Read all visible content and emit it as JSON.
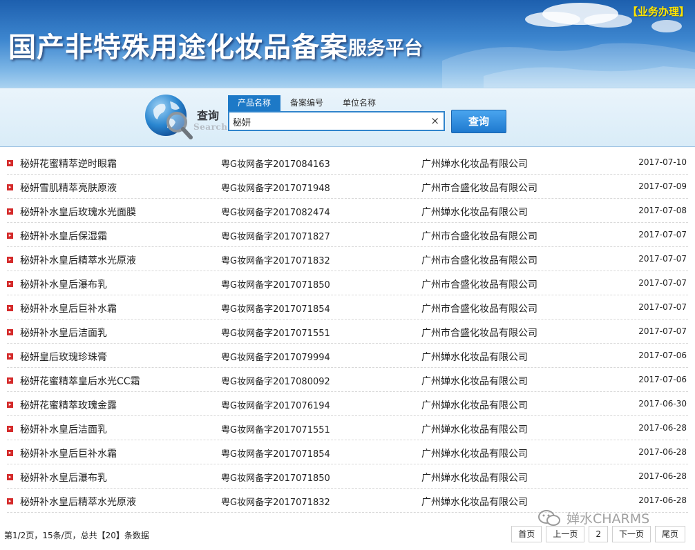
{
  "banner": {
    "title": "国产非特殊用途化妆品备案",
    "subtitle": "服务平台",
    "business_link": "【业务办理】"
  },
  "search": {
    "label_cn": "查询",
    "label_en": "Search",
    "tabs": [
      "产品名称",
      "备案编号",
      "单位名称"
    ],
    "active_tab": 0,
    "value": "秘妍",
    "clear": "×",
    "button": "查询"
  },
  "results": [
    {
      "name": "秘妍花蜜精萃逆时眼霜",
      "code": "粤G妆网备字2017084163",
      "company": "广州婵水化妆品有限公司",
      "date": "2017-07-10"
    },
    {
      "name": "秘妍雪肌精萃亮肤原液",
      "code": "粤G妆网备字2017071948",
      "company": "广州市合盛化妆品有限公司",
      "date": "2017-07-09"
    },
    {
      "name": "秘妍补水皇后玫瑰水光面膜",
      "code": "粤G妆网备字2017082474",
      "company": "广州婵水化妆品有限公司",
      "date": "2017-07-08"
    },
    {
      "name": "秘妍补水皇后保湿霜",
      "code": "粤G妆网备字2017071827",
      "company": "广州市合盛化妆品有限公司",
      "date": "2017-07-07"
    },
    {
      "name": "秘妍补水皇后精萃水光原液",
      "code": "粤G妆网备字2017071832",
      "company": "广州市合盛化妆品有限公司",
      "date": "2017-07-07"
    },
    {
      "name": "秘妍补水皇后瀑布乳",
      "code": "粤G妆网备字2017071850",
      "company": "广州市合盛化妆品有限公司",
      "date": "2017-07-07"
    },
    {
      "name": "秘妍补水皇后巨补水霜",
      "code": "粤G妆网备字2017071854",
      "company": "广州市合盛化妆品有限公司",
      "date": "2017-07-07"
    },
    {
      "name": "秘妍补水皇后洁面乳",
      "code": "粤G妆网备字2017071551",
      "company": "广州市合盛化妆品有限公司",
      "date": "2017-07-07"
    },
    {
      "name": "秘妍皇后玫瑰珍珠膏",
      "code": "粤G妆网备字2017079994",
      "company": "广州婵水化妆品有限公司",
      "date": "2017-07-06"
    },
    {
      "name": "秘妍花蜜精萃皇后水光CC霜",
      "code": "粤G妆网备字2017080092",
      "company": "广州婵水化妆品有限公司",
      "date": "2017-07-06"
    },
    {
      "name": "秘妍花蜜精萃玫瑰金露",
      "code": "粤G妆网备字2017076194",
      "company": "广州婵水化妆品有限公司",
      "date": "2017-06-30"
    },
    {
      "name": "秘妍补水皇后洁面乳",
      "code": "粤G妆网备字2017071551",
      "company": "广州婵水化妆品有限公司",
      "date": "2017-06-28"
    },
    {
      "name": "秘妍补水皇后巨补水霜",
      "code": "粤G妆网备字2017071854",
      "company": "广州婵水化妆品有限公司",
      "date": "2017-06-28"
    },
    {
      "name": "秘妍补水皇后瀑布乳",
      "code": "粤G妆网备字2017071850",
      "company": "广州婵水化妆品有限公司",
      "date": "2017-06-28"
    },
    {
      "name": "秘妍补水皇后精萃水光原液",
      "code": "粤G妆网备字2017071832",
      "company": "广州婵水化妆品有限公司",
      "date": "2017-06-28"
    }
  ],
  "footer": {
    "info": "第1/2页，15条/页，总共【20】条数据",
    "pager": [
      "首页",
      "上一页",
      "2",
      "下一页",
      "尾页"
    ]
  },
  "watermark": {
    "text": "婵水CHARMS"
  },
  "colors": {
    "banner_blue": "#1d5fae",
    "tab_active": "#1d79c7",
    "button_blue": "#1e79cf",
    "bullet_red": "#d42a2a",
    "business_link_yellow": "#ffe500"
  }
}
